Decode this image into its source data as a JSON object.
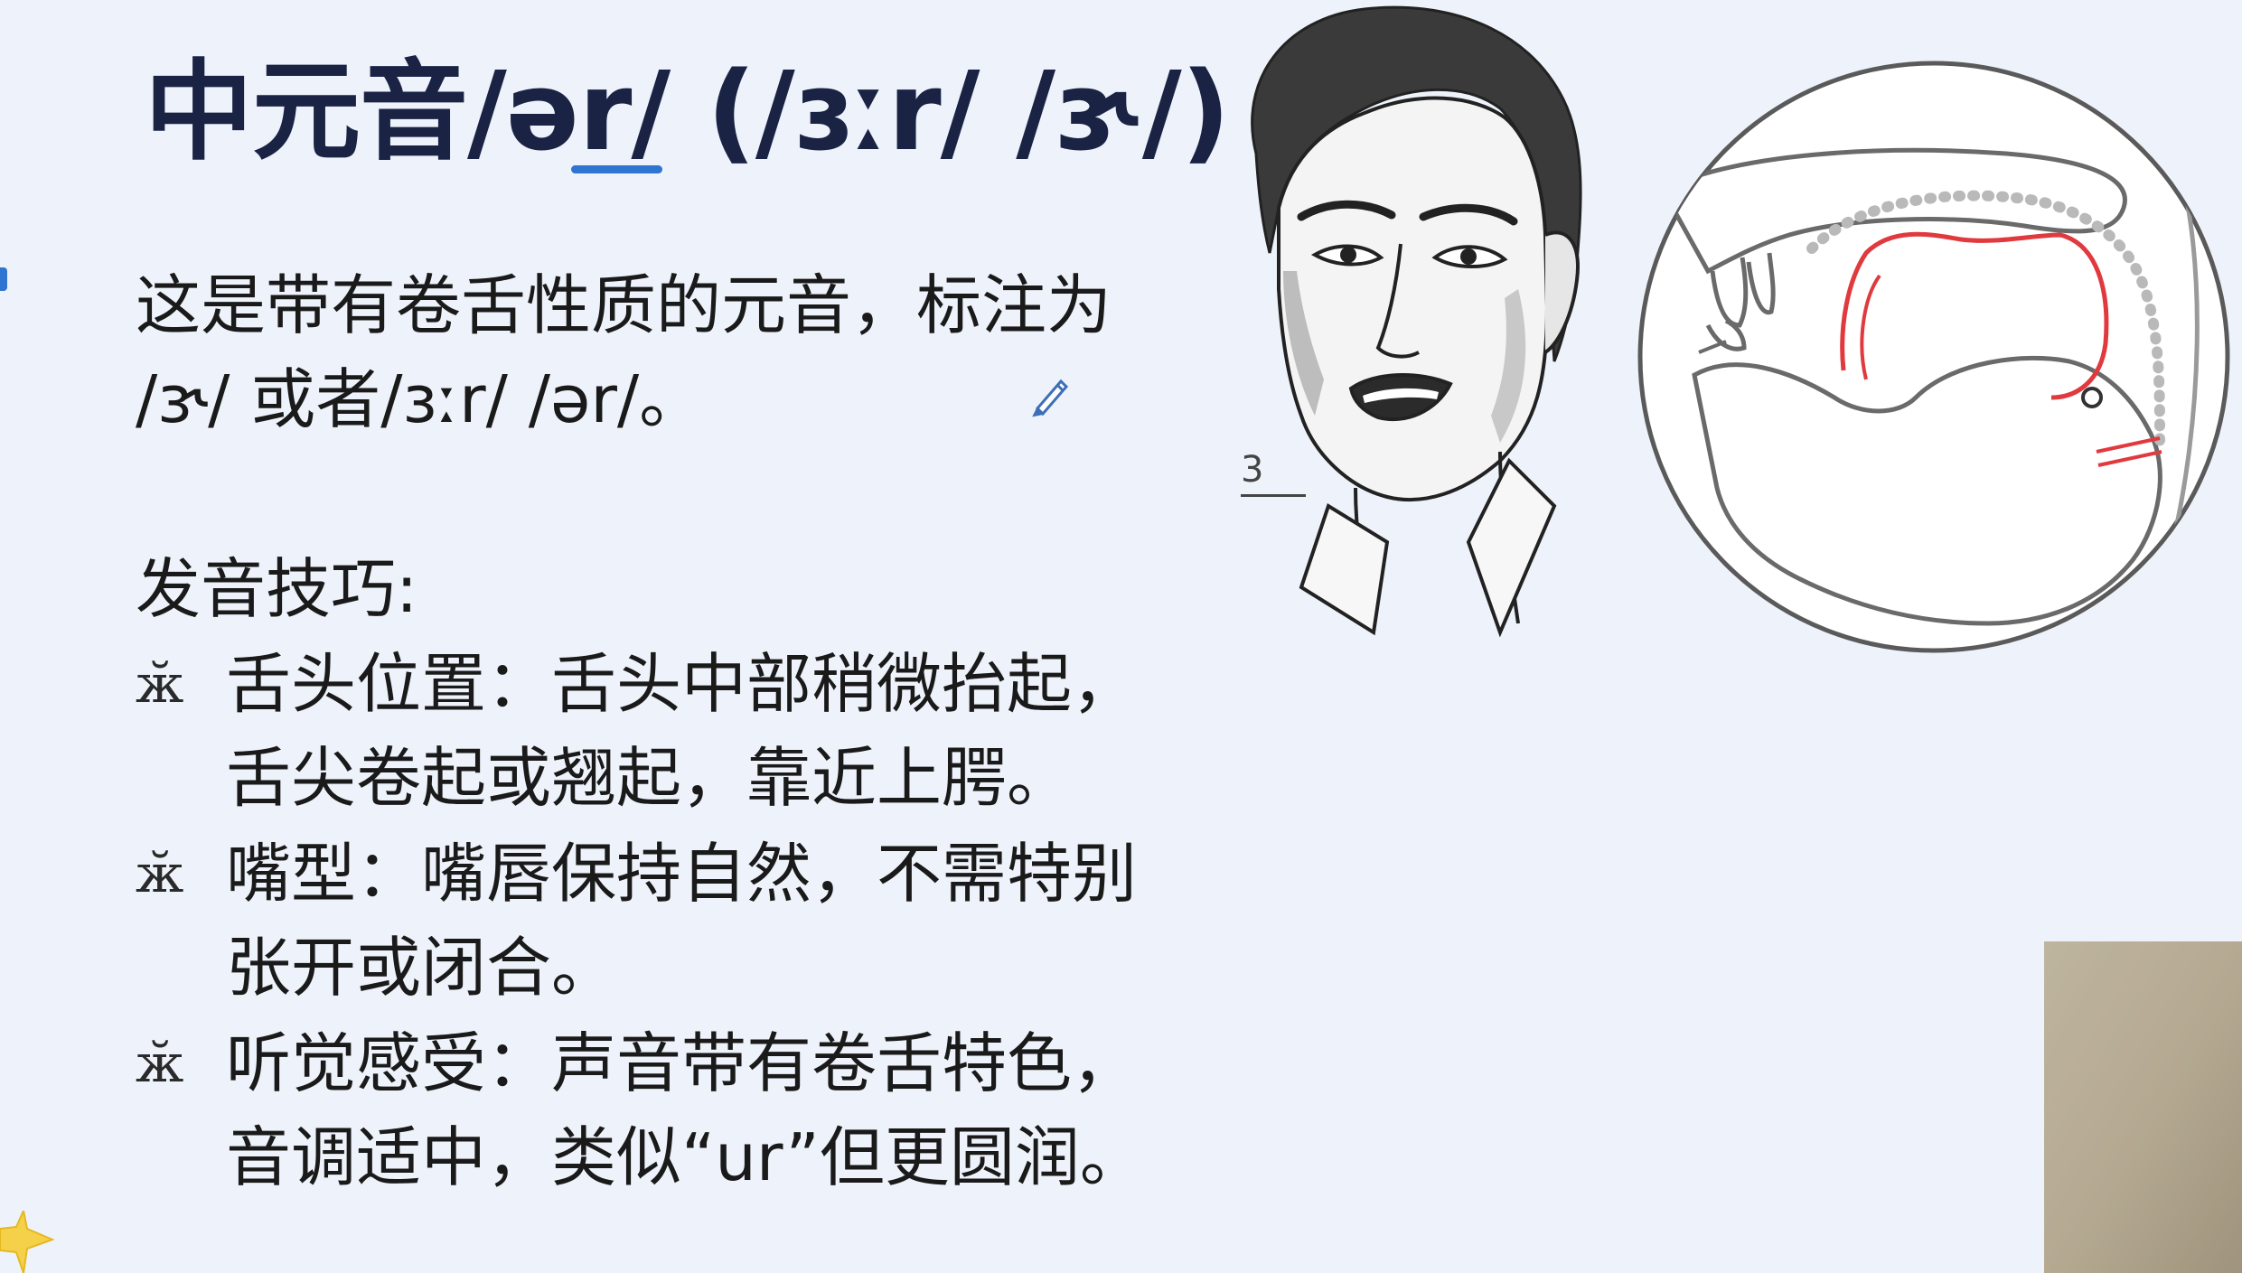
{
  "slide": {
    "title": {
      "prefix": "中元音/ə",
      "underlined": "r/",
      "suffix": " (/ɜːr/ /ɝ/)"
    },
    "intro": {
      "line1": "这是带有卷舌性质的元音，标注为",
      "line2": "/ɝ/ 或者/ɜːr/ /ər/。"
    },
    "tips_heading": "发音技巧:",
    "tips": [
      {
        "bullet": "ӂ",
        "lines": [
          "舌头位置：舌头中部稍微抬起，",
          "舌尖卷起或翘起，靠近上腭。"
        ]
      },
      {
        "bullet": "ӂ",
        "lines": [
          "嘴型：嘴唇保持自然，不需特别",
          "张开或闭合。"
        ]
      },
      {
        "bullet": "ӂ",
        "lines": [
          "听觉感受：声音带有卷舌特色，",
          "音调适中，类似“ur”但更圆润。"
        ]
      }
    ],
    "figure_number": "3"
  },
  "icons": {
    "pen": "pen-icon",
    "star": "star-icon"
  },
  "colors": {
    "background": "#eef3fb",
    "title": "#1b2345",
    "underline": "#2f74d0",
    "tongue_outline": "#e0393e"
  }
}
